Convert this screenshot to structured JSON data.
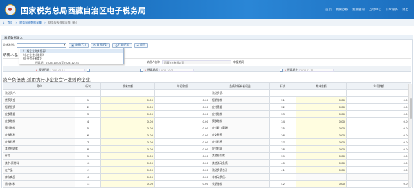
{
  "header": {
    "title": "国家税务总局西藏自治区电子税务局",
    "nav": [
      "首页",
      "我要办税",
      "我要查询",
      "互动中心",
      "公众服务",
      "退出"
    ]
  },
  "breadcrumb": {
    "home": "首页",
    "mid": "财务报表数据采集",
    "cur": "财务报表数据采集（新）"
  },
  "panel": {
    "title": "表单数据录入"
  },
  "toolbar": {
    "select_label": "会计准则:",
    "buttons": [
      "申报(F1)",
      "重置(F2)",
      "打印(F3)",
      "返回"
    ]
  },
  "dropdown": {
    "items": [
      "《一般企业财务报表》",
      "《小企业会计准则》",
      "《企业会计制度》"
    ],
    "subtext": "所属期：2024-10-01至2024-12-31"
  },
  "section1": {
    "title": "纳税人基"
  },
  "taxpayer": {
    "name_label": "纳税人名称",
    "name_value": "西藏××有限公司",
    "period_label": "申报期间"
  },
  "datebar": {
    "report_date_label": "报送日期",
    "report_date": "2025-01-14",
    "start_label": "所属期起",
    "start": "2024-10-01",
    "end_label": "所属期止",
    "end": "2024-12-31"
  },
  "section2": {
    "title": "资产负债表(适用执行小企业会计准则的企业)"
  },
  "columns": [
    "资产",
    "行次",
    "期末余额",
    "年初余额",
    "负债和所有者权益",
    "行次",
    "期末余额",
    "年初余额"
  ],
  "rows": [
    {
      "left": "流动资产:",
      "ln": "",
      "la": "",
      "lb": "",
      "right": "流动负债:",
      "rn": "",
      "ra": "",
      "rb": "",
      "group": true
    },
    {
      "left": "货币资金",
      "ln": "1",
      "la": "0.00",
      "lb": "0.00",
      "right": "短期借款",
      "rn": "31",
      "ra": "0.00",
      "rb": "0.00"
    },
    {
      "left": "短期投资",
      "ln": "2",
      "la": "0.00",
      "lb": "0.00",
      "right": "应付票据",
      "rn": "32",
      "ra": "0.00",
      "rb": "0.00"
    },
    {
      "left": "应收票据",
      "ln": "3",
      "la": "0.00",
      "lb": "0.00",
      "right": "应付账款",
      "rn": "33",
      "ra": "0.00",
      "rb": "0.00"
    },
    {
      "left": "应收账款",
      "ln": "4",
      "la": "0.00",
      "lb": "0.00",
      "right": "预收账款",
      "rn": "34",
      "ra": "0.00",
      "rb": "0.00"
    },
    {
      "left": "预付账款",
      "ln": "5",
      "la": "0.00",
      "lb": "0.00",
      "right": "应付职工薪酬",
      "rn": "35",
      "ra": "0.00",
      "rb": "0.00"
    },
    {
      "left": "应收股利",
      "ln": "6",
      "la": "0.00",
      "lb": "0.00",
      "right": "应交税费",
      "rn": "36",
      "ra": "0.00",
      "rb": "0.00"
    },
    {
      "left": "应收利息",
      "ln": "7",
      "la": "0.00",
      "lb": "0.00",
      "right": "应付利息",
      "rn": "37",
      "ra": "0.00",
      "rb": "0.00"
    },
    {
      "left": "其他应收款",
      "ln": "8",
      "la": "0.00",
      "lb": "0.00",
      "right": "应付利润",
      "rn": "38",
      "ra": "0.00",
      "rb": "0.00"
    },
    {
      "left": "存货",
      "ln": "9",
      "la": "0.00",
      "lb": "0.00",
      "right": "其他应付款",
      "rn": "39",
      "ra": "0.00",
      "rb": "0.00"
    },
    {
      "left": "其中:原材料",
      "ln": "10",
      "la": "0.00",
      "lb": "0.00",
      "right": "其他流动负债",
      "rn": "40",
      "ra": "0.00",
      "rb": "0.00"
    },
    {
      "left": "在产品",
      "ln": "11",
      "la": "0.00",
      "lb": "0.00",
      "right": "流动负债合计",
      "rn": "41",
      "ra": "0.00",
      "rb": "0.00"
    },
    {
      "left": "库存商品",
      "ln": "12",
      "la": "0.00",
      "lb": "0.00",
      "right": "非流动负债:",
      "rn": "",
      "ra": "",
      "rb": ""
    },
    {
      "left": "周转材料",
      "ln": "13",
      "la": "0.00",
      "lb": "0.00",
      "right": "长期借款",
      "rn": "42",
      "ra": "0.00",
      "rb": "0.00"
    }
  ]
}
